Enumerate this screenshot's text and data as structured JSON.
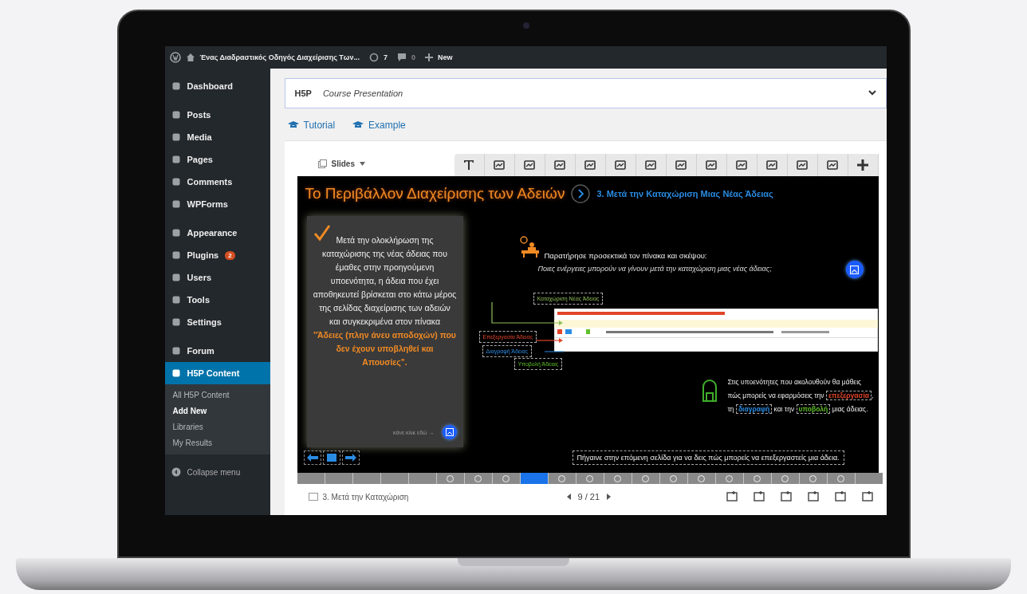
{
  "admin_bar": {
    "site_title": "Ένας Διαδραστικός Οδηγός Διαχείρισης Των...",
    "updates": "7",
    "comments": "0",
    "new": "New"
  },
  "sidebar": {
    "groups": [
      [
        {
          "label": "Dashboard",
          "selected": false
        }
      ],
      [
        {
          "label": "Posts",
          "selected": false
        },
        {
          "label": "Media",
          "selected": false
        },
        {
          "label": "Pages",
          "selected": false
        },
        {
          "label": "Comments",
          "selected": false
        },
        {
          "label": "WPForms",
          "selected": false
        }
      ],
      [
        {
          "label": "Appearance",
          "selected": false
        },
        {
          "label": "Plugins",
          "badge": "2",
          "selected": false
        },
        {
          "label": "Users",
          "selected": false
        },
        {
          "label": "Tools",
          "selected": false
        },
        {
          "label": "Settings",
          "selected": false
        }
      ],
      [
        {
          "label": "Forum",
          "selected": false
        },
        {
          "label": "H5P Content",
          "selected": true,
          "children": [
            {
              "label": "All H5P Content",
              "selected": false
            },
            {
              "label": "Add New",
              "selected": true
            },
            {
              "label": "Libraries",
              "selected": false
            },
            {
              "label": "My Results",
              "selected": false
            }
          ]
        }
      ]
    ],
    "collapse": "Collapse menu"
  },
  "editor": {
    "logo": "H5P",
    "content_type": "Course Presentation",
    "links": [
      "Tutorial",
      "Example"
    ],
    "slides_menu": "Slides"
  },
  "slide": {
    "title": "Το Περιβάλλον Διαχείρισης των Αδειών",
    "subtitle": "3. Μετά την Καταχώριση Μιας Νέας Άδειας",
    "card": {
      "text": "Μετά την ολοκλήρωση της καταχώρισης της νέας άδειας που έμαθες στην προηγούμενη υποενότητα, η άδεια που έχει αποθηκευτεί βρίσκεται στο κάτω μέρος της σελίδας διαχείρισης των αδειών και συγκεκριμένα στον πίνακα",
      "highlight": "\"Άδειες (πλην άνευ αποδοχών) που δεν έχουν υποβληθεί και Απουσίες\".",
      "link": "κάνε κλικ εδώ →"
    },
    "prompt": {
      "text": "Παρατήρησε προσεκτικά τον πίνακα και σκέψου:",
      "question": "Ποιες ενέργειες μπορούν να γίνουν μετά την καταχώριση μιας νέας άδειας;"
    },
    "callouts": [
      {
        "label": "Καταχώριση Νέας Άδειας",
        "kind": "create"
      },
      {
        "label": "Επεξεργασία Άδειας",
        "kind": "edit"
      },
      {
        "label": "Διαγραφή Άδειας",
        "kind": "delete"
      },
      {
        "label": "Υποβολή Άδειας",
        "kind": "submit"
      }
    ],
    "note": [
      {
        "text": "Στις υποενότητες που ακολουθούν θα μάθεις πώς μπορείς να εφαρμόσεις την ",
        "kind": "plain"
      },
      {
        "text": "επεξεργασία",
        "kind": "edit"
      },
      {
        "text": ", τη ",
        "kind": "plain"
      },
      {
        "text": "διαγραφή",
        "kind": "delete"
      },
      {
        "text": " και την ",
        "kind": "plain"
      },
      {
        "text": "υποβολή",
        "kind": "submit"
      },
      {
        "text": " μιας άδειας.",
        "kind": "plain"
      }
    ],
    "next_hint": "Πήγαινε στην επόμενη σελίδα για να δεις πώς μπορείς να επεξεργαστείς μια άδεια."
  },
  "progress": [
    {
      "selected": false,
      "marked": false
    },
    {
      "selected": false,
      "marked": false
    },
    {
      "selected": false,
      "marked": false
    },
    {
      "selected": false,
      "marked": false
    },
    {
      "selected": false,
      "marked": false
    },
    {
      "selected": false,
      "marked": true
    },
    {
      "selected": false,
      "marked": true
    },
    {
      "selected": false,
      "marked": true
    },
    {
      "selected": true,
      "marked": false
    },
    {
      "selected": false,
      "marked": true
    },
    {
      "selected": false,
      "marked": true
    },
    {
      "selected": false,
      "marked": true
    },
    {
      "selected": false,
      "marked": true
    },
    {
      "selected": false,
      "marked": true
    },
    {
      "selected": false,
      "marked": true
    },
    {
      "selected": false,
      "marked": true
    },
    {
      "selected": false,
      "marked": true
    },
    {
      "selected": false,
      "marked": true
    },
    {
      "selected": false,
      "marked": true
    },
    {
      "selected": false,
      "marked": true
    },
    {
      "selected": false,
      "marked": false
    }
  ],
  "footer": {
    "slide_title": "3. Μετά την Καταχώριση",
    "counter": "9 / 21"
  }
}
